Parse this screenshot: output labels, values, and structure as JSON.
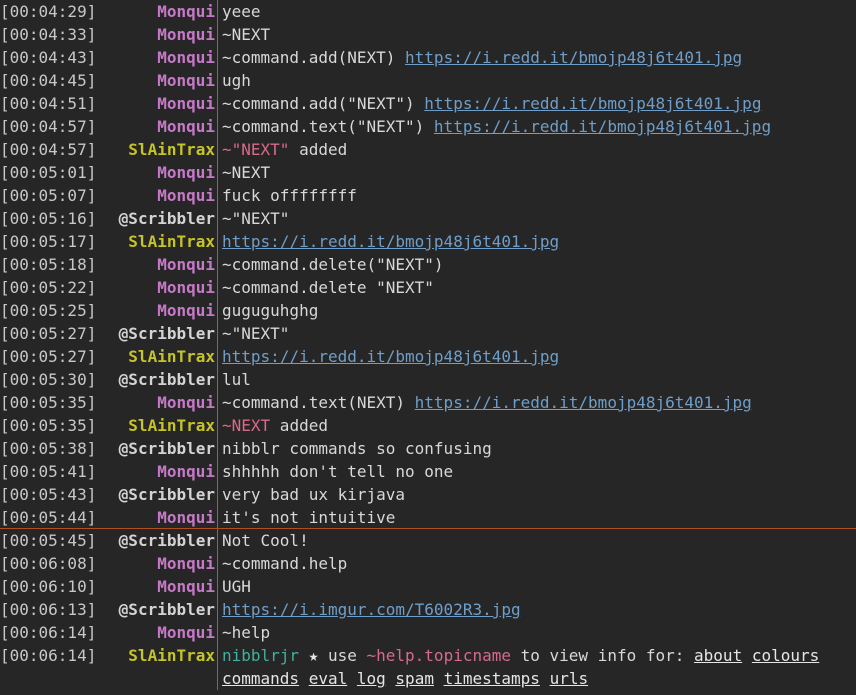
{
  "colors": {
    "background": "#262626",
    "nick_monqui": "#c779c9",
    "nick_slaintrax": "#c6c427",
    "nick_scribbler": "#d4d4d4",
    "link": "#6f9ec9",
    "highlight_pink": "#d86a8a",
    "bot_teal": "#3fb19f",
    "unread_marker": "#b04f1a"
  },
  "rows": [
    {
      "ts": "[00:04:29]",
      "nick": "Monqui",
      "parts": [
        {
          "t": "yeee"
        }
      ]
    },
    {
      "ts": "[00:04:33]",
      "nick": "Monqui",
      "parts": [
        {
          "t": "~NEXT"
        }
      ]
    },
    {
      "ts": "[00:04:43]",
      "nick": "Monqui",
      "parts": [
        {
          "t": "~command.add(NEXT) "
        },
        {
          "t": "https://i.redd.it/bmojp48j6t401.jpg",
          "k": "link"
        }
      ]
    },
    {
      "ts": "[00:04:45]",
      "nick": "Monqui",
      "parts": [
        {
          "t": "ugh"
        }
      ]
    },
    {
      "ts": "[00:04:51]",
      "nick": "Monqui",
      "parts": [
        {
          "t": "~command.add(\"NEXT\") "
        },
        {
          "t": "https://i.redd.it/bmojp48j6t401.jpg",
          "k": "link"
        }
      ]
    },
    {
      "ts": "[00:04:57]",
      "nick": "Monqui",
      "parts": [
        {
          "t": "~command.text(\"NEXT\") "
        },
        {
          "t": "https://i.redd.it/bmojp48j6t401.jpg",
          "k": "link"
        }
      ]
    },
    {
      "ts": "[00:04:57]",
      "nick": "SlAinTrax",
      "parts": [
        {
          "t": "~\"NEXT\"",
          "k": "pink"
        },
        {
          "t": " added"
        }
      ]
    },
    {
      "ts": "[00:05:01]",
      "nick": "Monqui",
      "parts": [
        {
          "t": "~NEXT"
        }
      ]
    },
    {
      "ts": "[00:05:07]",
      "nick": "Monqui",
      "parts": [
        {
          "t": "fuck offffffff"
        }
      ]
    },
    {
      "ts": "[00:05:16]",
      "nick": "@Scribbler",
      "parts": [
        {
          "t": "~\"NEXT\""
        }
      ]
    },
    {
      "ts": "[00:05:17]",
      "nick": "SlAinTrax",
      "parts": [
        {
          "t": "https://i.redd.it/bmojp48j6t401.jpg",
          "k": "link"
        }
      ]
    },
    {
      "ts": "[00:05:18]",
      "nick": "Monqui",
      "parts": [
        {
          "t": "~command.delete(\"NEXT\")"
        }
      ]
    },
    {
      "ts": "[00:05:22]",
      "nick": "Monqui",
      "parts": [
        {
          "t": "~command.delete \"NEXT\""
        }
      ]
    },
    {
      "ts": "[00:05:25]",
      "nick": "Monqui",
      "parts": [
        {
          "t": "guguguhghg"
        }
      ]
    },
    {
      "ts": "[00:05:27]",
      "nick": "@Scribbler",
      "parts": [
        {
          "t": "~\"NEXT\""
        }
      ]
    },
    {
      "ts": "[00:05:27]",
      "nick": "SlAinTrax",
      "parts": [
        {
          "t": "https://i.redd.it/bmojp48j6t401.jpg",
          "k": "link"
        }
      ]
    },
    {
      "ts": "[00:05:30]",
      "nick": "@Scribbler",
      "parts": [
        {
          "t": "lul"
        }
      ]
    },
    {
      "ts": "[00:05:35]",
      "nick": "Monqui",
      "parts": [
        {
          "t": "~command.text(NEXT) "
        },
        {
          "t": "https://i.redd.it/bmojp48j6t401.jpg",
          "k": "link"
        }
      ]
    },
    {
      "ts": "[00:05:35]",
      "nick": "SlAinTrax",
      "parts": [
        {
          "t": "~NEXT",
          "k": "pink"
        },
        {
          "t": " added"
        }
      ]
    },
    {
      "ts": "[00:05:38]",
      "nick": "@Scribbler",
      "parts": [
        {
          "t": "nibblr commands so confusing"
        }
      ]
    },
    {
      "ts": "[00:05:41]",
      "nick": "Monqui",
      "parts": [
        {
          "t": "shhhhh don't tell no one"
        }
      ]
    },
    {
      "ts": "[00:05:43]",
      "nick": "@Scribbler",
      "parts": [
        {
          "t": "very bad ux kirjava"
        }
      ]
    },
    {
      "ts": "[00:05:44]",
      "nick": "Monqui",
      "parts": [
        {
          "t": "it's not intuitive"
        }
      ]
    },
    {
      "ts": "[00:05:45]",
      "nick": "@Scribbler",
      "parts": [
        {
          "t": "Not Cool!"
        }
      ]
    },
    {
      "ts": "[00:06:08]",
      "nick": "Monqui",
      "parts": [
        {
          "t": "~command.help"
        }
      ]
    },
    {
      "ts": "[00:06:10]",
      "nick": "Monqui",
      "parts": [
        {
          "t": "UGH"
        }
      ]
    },
    {
      "ts": "[00:06:13]",
      "nick": "@Scribbler",
      "parts": [
        {
          "t": "https://i.imgur.com/T6002R3.jpg",
          "k": "link"
        }
      ]
    },
    {
      "ts": "[00:06:14]",
      "nick": "Monqui",
      "parts": [
        {
          "t": "~help"
        }
      ]
    },
    {
      "ts": "[00:06:14]",
      "nick": "SlAinTrax",
      "parts": [
        {
          "t": "nibblrjr",
          "k": "teal"
        },
        {
          "t": " ★ ",
          "k": "star"
        },
        {
          "t": "use "
        },
        {
          "t": "~help.topicname",
          "k": "pink"
        },
        {
          "t": " to view info for: "
        },
        {
          "t": "about",
          "k": "ul"
        },
        {
          "t": " "
        },
        {
          "t": "colours",
          "k": "ul"
        }
      ]
    },
    {
      "ts": "",
      "nick": "",
      "parts": [
        {
          "t": "commands",
          "k": "ul"
        },
        {
          "t": " "
        },
        {
          "t": "eval",
          "k": "ul"
        },
        {
          "t": " "
        },
        {
          "t": "log",
          "k": "ul"
        },
        {
          "t": " "
        },
        {
          "t": "spam",
          "k": "ul"
        },
        {
          "t": " "
        },
        {
          "t": "timestamps",
          "k": "ul"
        },
        {
          "t": " "
        },
        {
          "t": "urls",
          "k": "ul"
        }
      ]
    }
  ],
  "unread_marker_after_row": 22
}
